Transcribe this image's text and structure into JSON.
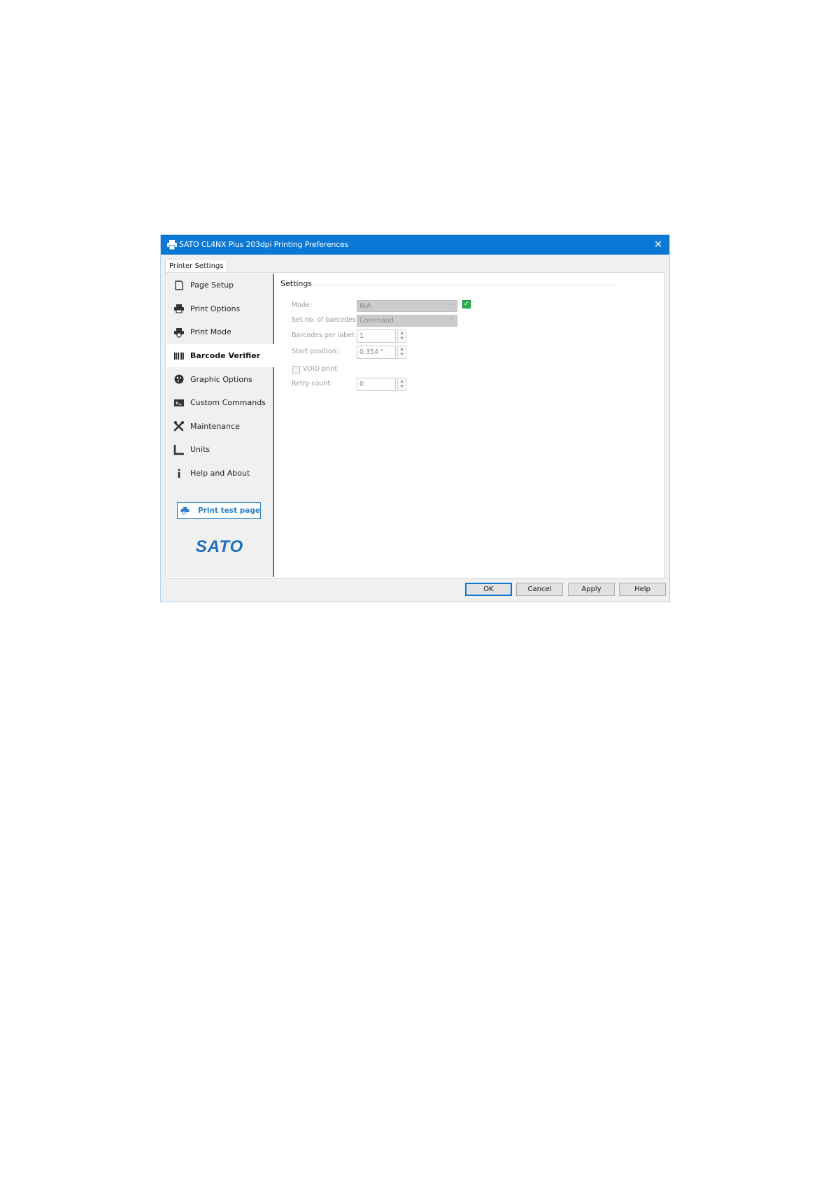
{
  "window": {
    "title": "SATO CL4NX Plus 203dpi Printing Preferences",
    "close_glyph": "✕"
  },
  "tabs": [
    {
      "label": "Printer Settings"
    }
  ],
  "sidebar": {
    "items": [
      {
        "label": "Page Setup",
        "icon": "page-icon"
      },
      {
        "label": "Print Options",
        "icon": "printer-icon"
      },
      {
        "label": "Print Mode",
        "icon": "print-mode-icon"
      },
      {
        "label": "Barcode Verifier",
        "icon": "barcode-icon",
        "active": true
      },
      {
        "label": "Graphic Options",
        "icon": "graphic-icon"
      },
      {
        "label": "Custom Commands",
        "icon": "terminal-icon"
      },
      {
        "label": "Maintenance",
        "icon": "wrench-icon"
      },
      {
        "label": "Units",
        "icon": "ruler-icon"
      },
      {
        "label": "Help and About",
        "icon": "info-icon"
      }
    ],
    "test_page_label": "Print test page",
    "logo_text": "SATO"
  },
  "settings": {
    "title": "Settings",
    "mode": {
      "label": "Mode:",
      "value": "N/A"
    },
    "barcodes_count": {
      "label": "Set no. of barcodes:",
      "value": "Command"
    },
    "barcodes_per_label": {
      "label": "Barcodes per label:",
      "value": "1"
    },
    "start_position": {
      "label": "Start position:",
      "value": "0.354 \""
    },
    "void_print": {
      "label": "VOID print"
    },
    "retry_count": {
      "label": "Retry count:",
      "value": "0"
    }
  },
  "footer": {
    "ok": "OK",
    "cancel": "Cancel",
    "apply": "Apply",
    "help": "Help"
  },
  "colors": {
    "titlebar": "#0a78d4",
    "accent": "#2b7fc6",
    "check": "#26b14a"
  }
}
